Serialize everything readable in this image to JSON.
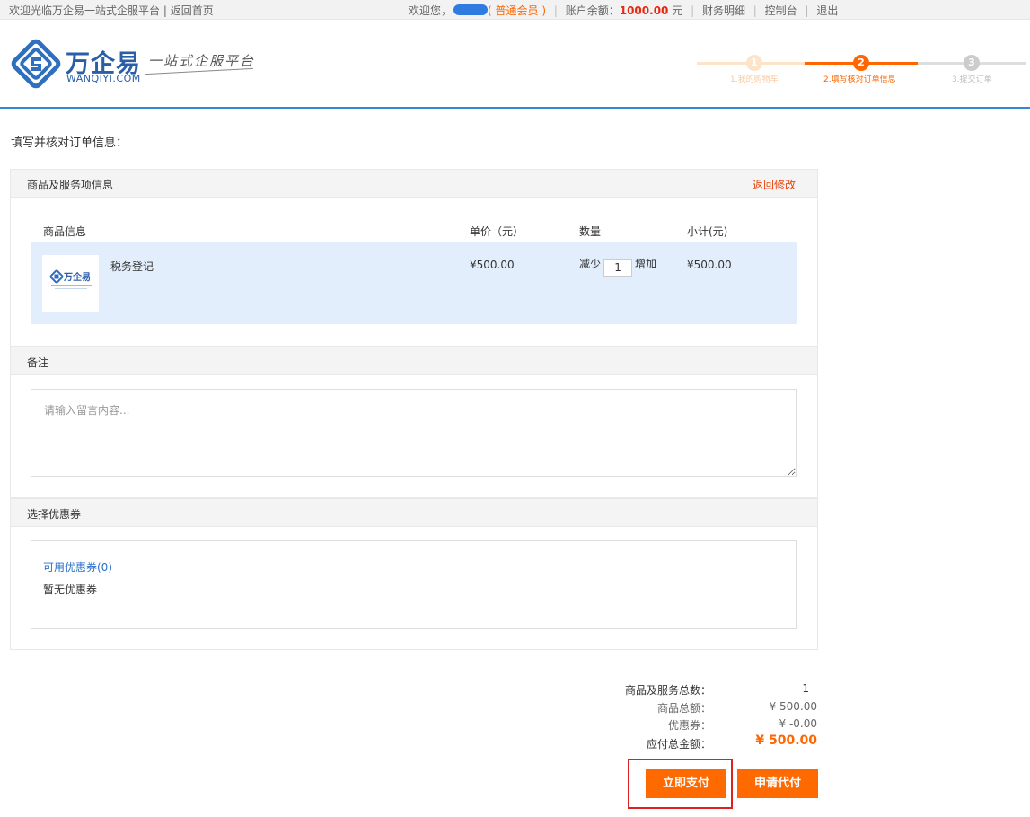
{
  "topbar": {
    "welcome": "欢迎光临万企易一站式企服平台",
    "divider": "|",
    "home_link": "返回首页",
    "greeting": "欢迎您，",
    "member_level": "( 普通会员 )",
    "balance_label": "账户余额：",
    "balance_value": "1000.00",
    "balance_unit": "元",
    "finance": "财务明细",
    "console": "控制台",
    "logout": "退出"
  },
  "brand": {
    "name": "万企易",
    "domain": "WANQIYI.COM",
    "slogan": "一站式企服平台"
  },
  "steps": [
    {
      "num": "1",
      "label": "1.我的购物车",
      "color": "#fde3c8"
    },
    {
      "num": "2",
      "label": "2.填写核对订单信息",
      "color": "#ff6600"
    },
    {
      "num": "3",
      "label": "3.提交订单",
      "color": "#cccccc"
    }
  ],
  "page_title": "填写并核对订单信息：",
  "goods_section": {
    "title": "商品及服务项信息",
    "back_label": "返回修改",
    "columns": [
      "商品信息",
      "单价（元）",
      "数量",
      "小计(元)"
    ],
    "item": {
      "thumb_brand": "万企易",
      "name": "税务登记",
      "price": "¥500.00",
      "decrease": "减少",
      "quantity": "1",
      "increase": "增加",
      "subtotal": "¥500.00"
    }
  },
  "remark_section": {
    "title": "备注",
    "placeholder": "请输入留言内容..."
  },
  "coupon_section": {
    "title": "选择优惠券",
    "available_link": "可用优惠券(0)",
    "none_text": "暂无优惠券"
  },
  "summary": {
    "count_label": "商品及服务总数：",
    "count_value": "1",
    "total_label": "商品总额：",
    "total_value": "¥  500.00",
    "coupon_label": "优惠券：",
    "coupon_value": "¥  -0.00",
    "payable_label": "应付总金额：",
    "payable_value": "¥  500.00"
  },
  "buttons": {
    "pay_now": "立即支付",
    "request_proxy": "申请代付"
  },
  "colors": {
    "accent": "#ff6600",
    "brand_blue": "#2a5fa8",
    "link_blue": "#2a6fc9",
    "header_rule": "#3a86d6",
    "highlight_red": "#e02020"
  }
}
